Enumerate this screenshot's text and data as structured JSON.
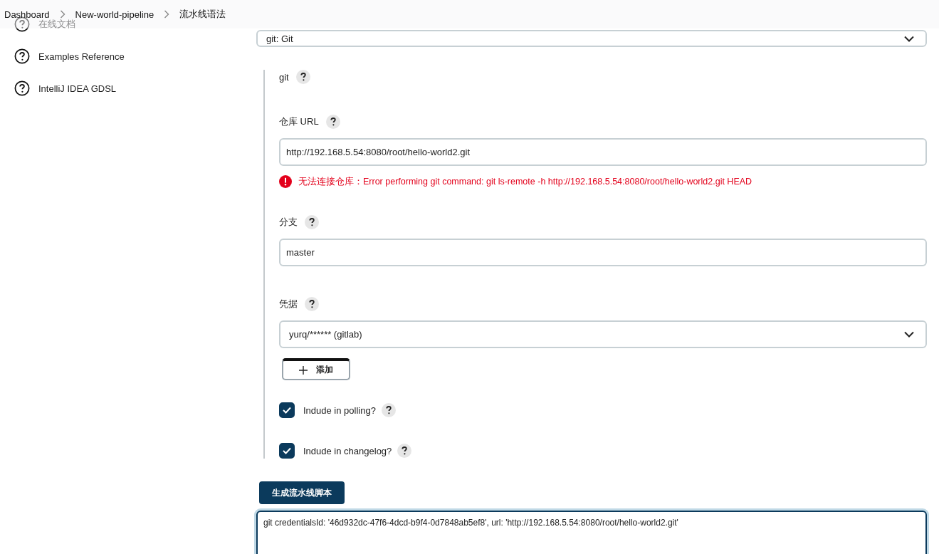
{
  "breadcrumb": [
    {
      "label": "Dashboard"
    },
    {
      "label": "New-world-pipeline"
    },
    {
      "label": "流水线语法"
    }
  ],
  "sidebar": {
    "items": [
      {
        "label": "在线文档"
      },
      {
        "label": "Examples Reference"
      },
      {
        "label": "IntelliJ IDEA GDSL"
      }
    ]
  },
  "sample_step": {
    "value": "git: Git"
  },
  "git_section": {
    "title": "git",
    "fields": [
      {
        "kind": "text",
        "label": "仓库 URL",
        "value": "http://192.168.5.54:8080/root/hello-world2.git",
        "error": "无法连接仓库：Error performing git command: git ls-remote -h http://192.168.5.54:8080/root/hello-world2.git HEAD"
      },
      {
        "kind": "text",
        "label": "分支",
        "value": "master"
      },
      {
        "kind": "select",
        "label": "凭据",
        "value": "yurq/****** (gitlab)",
        "add_button": "添加"
      },
      {
        "kind": "checkbox",
        "label": "Indude in polling?",
        "checked": true
      },
      {
        "kind": "checkbox",
        "label": "Indude in changelog?",
        "checked": true
      }
    ]
  },
  "generate_button": "生成流水线脚本",
  "script_output": "git credentialsId: '46d932dc-47f6-4dcd-b9f4-0d7848ab5ef8', url: 'http://192.168.5.54:8080/root/hello-world2.git'"
}
